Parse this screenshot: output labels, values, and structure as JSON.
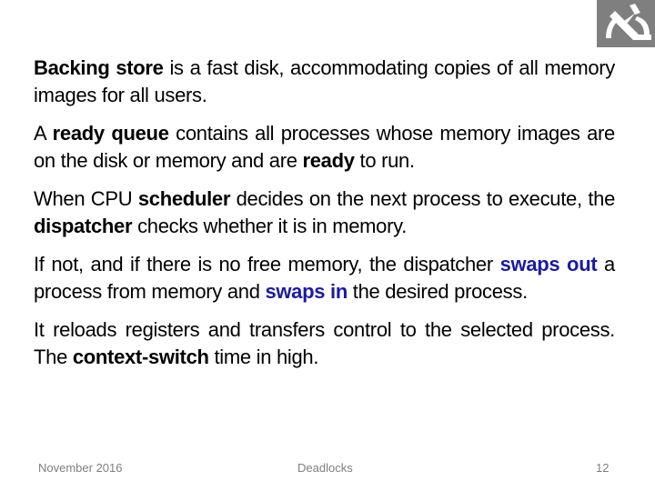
{
  "logo": {
    "icon": "microscope-logo-icon",
    "background": "#7f7f7f"
  },
  "paragraphs": [
    {
      "segments": [
        {
          "text": "Backing store",
          "style": "bold"
        },
        {
          "text": " is a fast disk, accommodating copies of all memory images for all users.",
          "style": "normal"
        }
      ]
    },
    {
      "segments": [
        {
          "text": "A ",
          "style": "normal"
        },
        {
          "text": "ready queue",
          "style": "bold"
        },
        {
          "text": " contains all processes whose memory images are on the disk or memory and are ",
          "style": "normal"
        },
        {
          "text": "ready",
          "style": "bold"
        },
        {
          "text": " to run.",
          "style": "normal"
        }
      ]
    },
    {
      "segments": [
        {
          "text": "When CPU ",
          "style": "normal"
        },
        {
          "text": "scheduler",
          "style": "bold"
        },
        {
          "text": " decides on the next process to execute, the ",
          "style": "normal"
        },
        {
          "text": "dispatcher",
          "style": "bold"
        },
        {
          "text": " checks whether it is in memory.",
          "style": "normal"
        }
      ]
    },
    {
      "segments": [
        {
          "text": "If not, and if there is no free memory, the dispatcher ",
          "style": "normal"
        },
        {
          "text": "swaps out",
          "style": "blue"
        },
        {
          "text": " a process from memory and ",
          "style": "normal"
        },
        {
          "text": "swaps in",
          "style": "blue"
        },
        {
          "text": " the desired process.",
          "style": "normal"
        }
      ]
    },
    {
      "segments": [
        {
          "text": "It reloads registers and transfers control to the selected process. The ",
          "style": "normal"
        },
        {
          "text": "context-switch",
          "style": "bold"
        },
        {
          "text": " time in high.",
          "style": "normal"
        }
      ]
    }
  ],
  "colors": {
    "highlight_blue": "#1a1aa6",
    "footer_gray": "#7f7f7f"
  },
  "footer": {
    "date": "November 2016",
    "title": "Deadlocks",
    "page_number": "12"
  }
}
